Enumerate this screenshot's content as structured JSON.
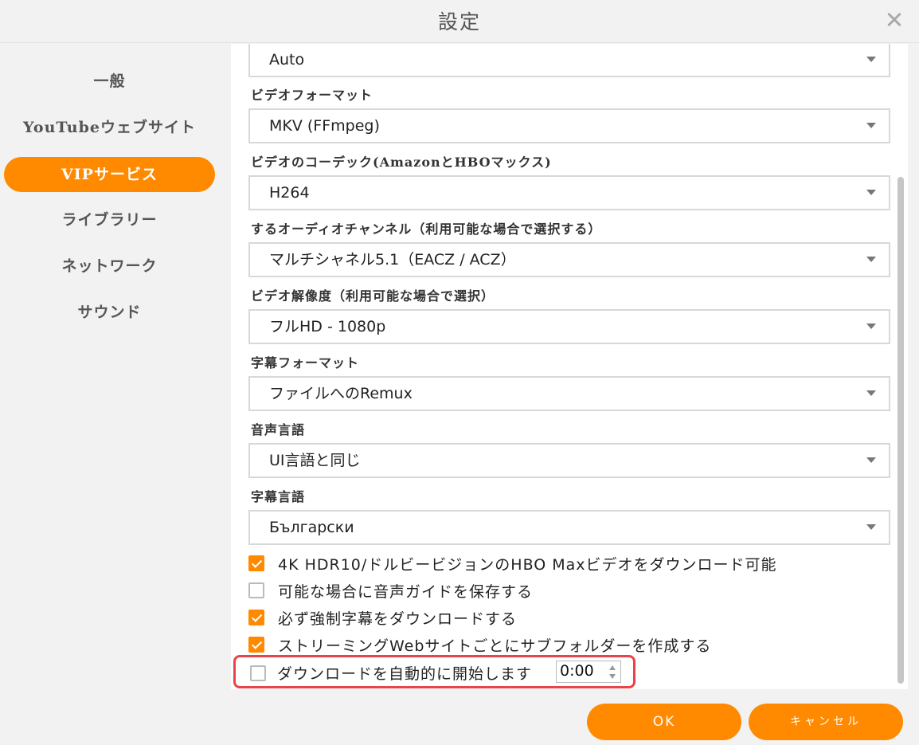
{
  "window": {
    "title": "設定"
  },
  "sidebar": {
    "items": [
      {
        "label": "一般",
        "active": false
      },
      {
        "label": "YouTubeウェブサイト",
        "active": false
      },
      {
        "label": "VIPサービス",
        "active": true
      },
      {
        "label": "ライブラリー",
        "active": false
      },
      {
        "label": "ネットワーク",
        "active": false
      },
      {
        "label": "サウンド",
        "active": false
      }
    ]
  },
  "settings": {
    "top_select": {
      "value": "Auto"
    },
    "video_format": {
      "label": "ビデオフォーマット",
      "value": "MKV (FFmpeg)"
    },
    "video_codec": {
      "label": "ビデオのコーデック(AmazonとHBOマックス)",
      "value": "H264"
    },
    "audio_channel": {
      "label": "するオーディオチャンネル（利用可能な場合で選択する）",
      "value": "マルチシャネル5.1（EACZ / ACZ）"
    },
    "video_resolution": {
      "label": "ビデオ解像度（利用可能な場合で選択）",
      "value": "フルHD - 1080p"
    },
    "subtitle_format": {
      "label": "字幕フォーマット",
      "value": "ファイルへのRemux"
    },
    "audio_language": {
      "label": "音声言語",
      "value": "UI言語と同じ"
    },
    "subtitle_language": {
      "label": "字幕言語",
      "value": "Български"
    }
  },
  "checkboxes": [
    {
      "label": "4K HDR10/ドルビービジョンのHBO Maxビデオをダウンロード可能",
      "checked": true
    },
    {
      "label": "可能な場合に音声ガイドを保存する",
      "checked": false
    },
    {
      "label": "必ず強制字幕をダウンロードする",
      "checked": true
    },
    {
      "label": "ストリーミングWebサイトごとにサブフォルダーを作成する",
      "checked": true
    }
  ],
  "autostart": {
    "label": "ダウンロードを自動的に開始します",
    "checked": false,
    "time": "0:00"
  },
  "buttons": {
    "ok": "OK",
    "cancel": "キャンセル"
  },
  "colors": {
    "accent": "#ff8a00",
    "highlight_border": "#e8454a"
  }
}
